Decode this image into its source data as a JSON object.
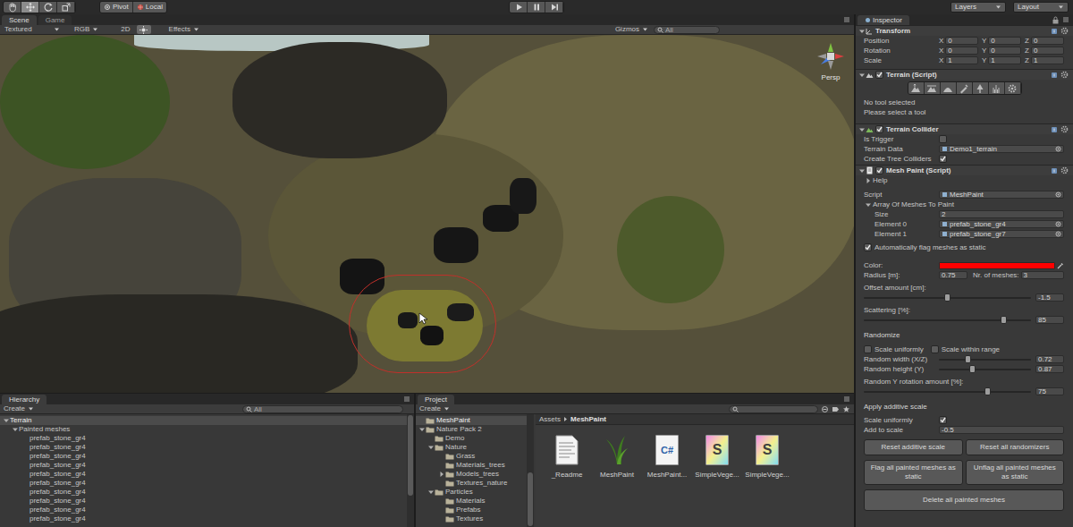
{
  "toolbar": {
    "tools": [
      {
        "kind": "hand",
        "selected": false
      },
      {
        "kind": "move",
        "selected": true
      },
      {
        "kind": "rotate",
        "selected": false
      },
      {
        "kind": "scale",
        "selected": false
      }
    ],
    "pivot": "Pivot",
    "local": "Local",
    "playback": [
      {
        "kind": "play",
        "selected": false
      },
      {
        "kind": "pause",
        "selected": false
      },
      {
        "kind": "step",
        "selected": false
      }
    ],
    "layers": "Layers",
    "layout": "Layout"
  },
  "scene": {
    "tabs": [
      {
        "label": "Scene",
        "selected": true
      },
      {
        "label": "Game",
        "selected": false
      }
    ],
    "shading": "Textured",
    "render_mode": "RGB",
    "mode_2d": "2D",
    "lighting_on": true,
    "effects": "Effects",
    "gizmos": "Gizmos",
    "search_placeholder": "All",
    "view_label": "Persp"
  },
  "inspector": {
    "tab": "Inspector",
    "transform": {
      "title": "Transform",
      "expanded": true,
      "rows": [
        {
          "label": "Position",
          "values": [
            {
              "axis": "X",
              "value": "0"
            },
            {
              "axis": "Y",
              "value": "0"
            },
            {
              "axis": "Z",
              "value": "0"
            }
          ]
        },
        {
          "label": "Rotation",
          "values": [
            {
              "axis": "X",
              "value": "0"
            },
            {
              "axis": "Y",
              "value": "0"
            },
            {
              "axis": "Z",
              "value": "0"
            }
          ]
        },
        {
          "label": "Scale",
          "values": [
            {
              "axis": "X",
              "value": "1"
            },
            {
              "axis": "Y",
              "value": "1"
            },
            {
              "axis": "Z",
              "value": "1"
            }
          ]
        }
      ]
    },
    "terrain": {
      "title": "Terrain (Script)",
      "expanded": true,
      "enabled": true,
      "tools": [
        {
          "kind": "raise",
          "selected": false
        },
        {
          "kind": "height",
          "selected": false
        },
        {
          "kind": "smooth",
          "selected": false
        },
        {
          "kind": "paint",
          "selected": false
        },
        {
          "kind": "trees",
          "selected": false
        },
        {
          "kind": "details",
          "selected": false
        },
        {
          "kind": "settings",
          "selected": false
        }
      ],
      "messages": [
        "No tool selected",
        "Please select a tool"
      ]
    },
    "collider": {
      "title": "Terrain Collider",
      "expanded": true,
      "enabled": true,
      "rows": [
        {
          "kind": "toggle-field",
          "label": "Is Trigger",
          "checked": false
        },
        {
          "kind": "object",
          "label": "Terrain Data",
          "value": "Demo1_terrain"
        },
        {
          "kind": "toggle-field",
          "label": "Create Tree Colliders",
          "checked": true
        }
      ]
    },
    "mesh_paint": {
      "title": "Mesh Paint (Script)",
      "expanded": true,
      "enabled": true,
      "rows": [
        {
          "kind": "foldout",
          "label": "Help",
          "expanded": false
        },
        {
          "kind": "object",
          "label": "Script",
          "value": "MeshPaint"
        },
        {
          "kind": "foldout",
          "label": "Array Of Meshes To Paint",
          "expanded": true
        },
        {
          "kind": "array-size",
          "label": "Size",
          "value": "2"
        },
        {
          "kind": "array-item",
          "label": "Element 0",
          "value": "prefab_stone_gr4"
        },
        {
          "kind": "array-item",
          "label": "Element 1",
          "value": "prefab_stone_gr7"
        },
        {
          "kind": "checkbox",
          "label": "Automatically flag meshes as static",
          "checked": true
        },
        {
          "kind": "color",
          "label": "Color:",
          "color": "#ff0000"
        },
        {
          "kind": "pair",
          "label": "Radius [m]:",
          "value": "0.75",
          "label2": "Nr. of meshes:",
          "value2": "3"
        },
        {
          "kind": "caption",
          "label": "Offset amount [cm]:"
        },
        {
          "kind": "slider",
          "level": 0.5,
          "value": "-1.5"
        },
        {
          "kind": "caption",
          "label": "Scattering [%]:"
        },
        {
          "kind": "slider",
          "level": 0.85,
          "value": "85"
        },
        {
          "kind": "section",
          "label": "Randomize"
        },
        {
          "kind": "checkbox-pair",
          "items": [
            {
              "label": "Scale uniformly",
              "checked": false
            },
            {
              "label": "Scale within range",
              "checked": false
            }
          ]
        },
        {
          "kind": "labeled-slider",
          "label": "Random width (X/Z)",
          "level": 0.3,
          "value": "0.72"
        },
        {
          "kind": "labeled-slider",
          "label": "Random height (Y)",
          "level": 0.35,
          "value": "0.87"
        },
        {
          "kind": "caption",
          "label": "Random Y rotation amount [%]:"
        },
        {
          "kind": "slider",
          "level": 0.75,
          "value": "75"
        },
        {
          "kind": "section",
          "label": "Apply additive scale"
        },
        {
          "kind": "toggle-field",
          "label": "Scale uniformly",
          "checked": true
        },
        {
          "kind": "text",
          "label": "Add to scale",
          "value": "-0.5"
        },
        {
          "kind": "buttons",
          "buttons": [
            "Reset additive scale",
            "Reset all randomizers"
          ]
        },
        {
          "kind": "buttons",
          "buttons": [
            "Flag all painted meshes as static",
            "Unflag all painted meshes as static"
          ]
        },
        {
          "kind": "buttons",
          "buttons": [
            "Delete all painted meshes"
          ]
        }
      ]
    }
  },
  "hierarchy": {
    "tab": "Hierarchy",
    "create": "Create",
    "search_placeholder": "All",
    "items": [
      {
        "label": "Terrain",
        "selected": true,
        "expanded": true,
        "children": [
          {
            "label": "Painted meshes",
            "selected": false,
            "expanded": true,
            "children": [
              {
                "label": "prefab_stone_gr4",
                "selected": false
              },
              {
                "label": "prefab_stone_gr4",
                "selected": false
              },
              {
                "label": "prefab_stone_gr4",
                "selected": false
              },
              {
                "label": "prefab_stone_gr4",
                "selected": false
              },
              {
                "label": "prefab_stone_gr4",
                "selected": false
              },
              {
                "label": "prefab_stone_gr4",
                "selected": false
              },
              {
                "label": "prefab_stone_gr4",
                "selected": false
              },
              {
                "label": "prefab_stone_gr4",
                "selected": false
              },
              {
                "label": "prefab_stone_gr4",
                "selected": false
              },
              {
                "label": "prefab_stone_gr4",
                "selected": false
              }
            ]
          }
        ]
      }
    ]
  },
  "project": {
    "tab": "Project",
    "create": "Create",
    "tree": [
      {
        "label": "MeshPaint",
        "selected": true
      },
      {
        "label": "Nature Pack 2",
        "selected": false,
        "expanded": true,
        "children": [
          {
            "label": "Demo",
            "selected": false
          },
          {
            "label": "Nature",
            "selected": false,
            "expanded": true,
            "children": [
              {
                "label": "Grass",
                "selected": false
              },
              {
                "label": "Materials_trees",
                "selected": false
              },
              {
                "label": "Models_trees",
                "selected": false,
                "expanded": false
              },
              {
                "label": "Textures_nature",
                "selected": false
              }
            ]
          },
          {
            "label": "Particles",
            "selected": false,
            "expanded": true,
            "children": [
              {
                "label": "Materials",
                "selected": false
              },
              {
                "label": "Prefabs",
                "selected": false
              },
              {
                "label": "Textures",
                "selected": false
              }
            ]
          }
        ]
      }
    ],
    "breadcrumb": [
      "Assets",
      "MeshPaint"
    ],
    "assets": [
      {
        "label": "_Readme",
        "kind": "document"
      },
      {
        "label": "MeshPaint",
        "kind": "grass"
      },
      {
        "label": "MeshPaint...",
        "kind": "script",
        "glyph": "C#"
      },
      {
        "label": "SimpleVege...",
        "kind": "shader",
        "glyph": "S"
      },
      {
        "label": "SimpleVege...",
        "kind": "shader",
        "glyph": "S"
      }
    ]
  }
}
